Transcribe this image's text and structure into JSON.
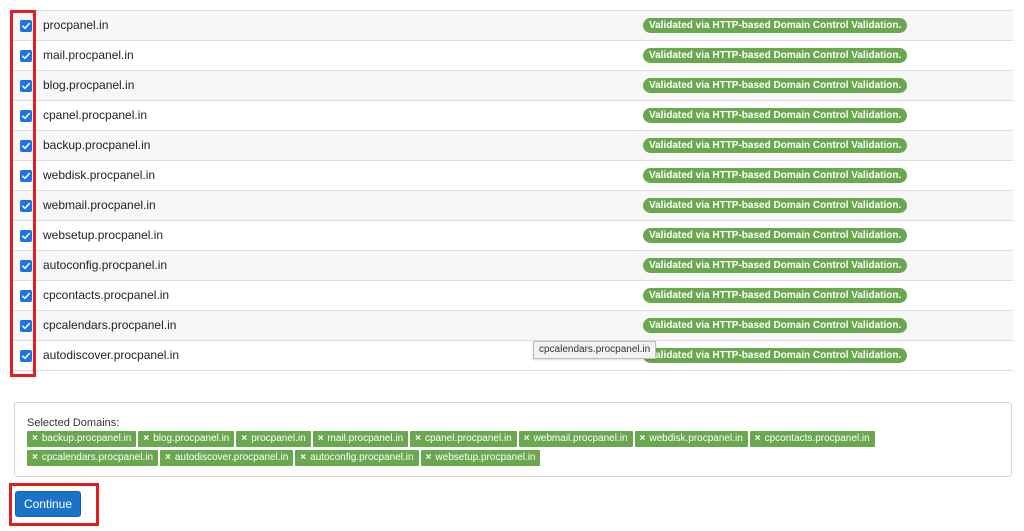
{
  "domains": [
    {
      "name": "procpanel.in",
      "checked": true,
      "status": "Validated via HTTP-based Domain Control Validation."
    },
    {
      "name": "mail.procpanel.in",
      "checked": true,
      "status": "Validated via HTTP-based Domain Control Validation."
    },
    {
      "name": "blog.procpanel.in",
      "checked": true,
      "status": "Validated via HTTP-based Domain Control Validation."
    },
    {
      "name": "cpanel.procpanel.in",
      "checked": true,
      "status": "Validated via HTTP-based Domain Control Validation."
    },
    {
      "name": "backup.procpanel.in",
      "checked": true,
      "status": "Validated via HTTP-based Domain Control Validation."
    },
    {
      "name": "webdisk.procpanel.in",
      "checked": true,
      "status": "Validated via HTTP-based Domain Control Validation."
    },
    {
      "name": "webmail.procpanel.in",
      "checked": true,
      "status": "Validated via HTTP-based Domain Control Validation."
    },
    {
      "name": "websetup.procpanel.in",
      "checked": true,
      "status": "Validated via HTTP-based Domain Control Validation."
    },
    {
      "name": "autoconfig.procpanel.in",
      "checked": true,
      "status": "Validated via HTTP-based Domain Control Validation."
    },
    {
      "name": "cpcontacts.procpanel.in",
      "checked": true,
      "status": "Validated via HTTP-based Domain Control Validation."
    },
    {
      "name": "cpcalendars.procpanel.in",
      "checked": true,
      "status": "Validated via HTTP-based Domain Control Validation."
    },
    {
      "name": "autodiscover.procpanel.in",
      "checked": true,
      "status": "Validated via HTTP-based Domain Control Validation."
    }
  ],
  "tooltip": {
    "text": "cpcalendars.procpanel.in"
  },
  "selected": {
    "label": "Selected Domains:",
    "remove_glyph": "×",
    "chips_row1": [
      "backup.procpanel.in",
      "blog.procpanel.in",
      "procpanel.in",
      "mail.procpanel.in",
      "cpanel.procpanel.in",
      "webmail.procpanel.in",
      "webdisk.procpanel.in",
      "cpcontacts.procpanel.in"
    ],
    "chips_row2": [
      "cpcalendars.procpanel.in",
      "autodiscover.procpanel.in",
      "autoconfig.procpanel.in",
      "websetup.procpanel.in"
    ]
  },
  "actions": {
    "continue_label": "Continue"
  },
  "colors": {
    "accent": "#1a73e8",
    "badge": "#6aa84f",
    "highlight": "#e02020",
    "button": "#1a73c8"
  }
}
